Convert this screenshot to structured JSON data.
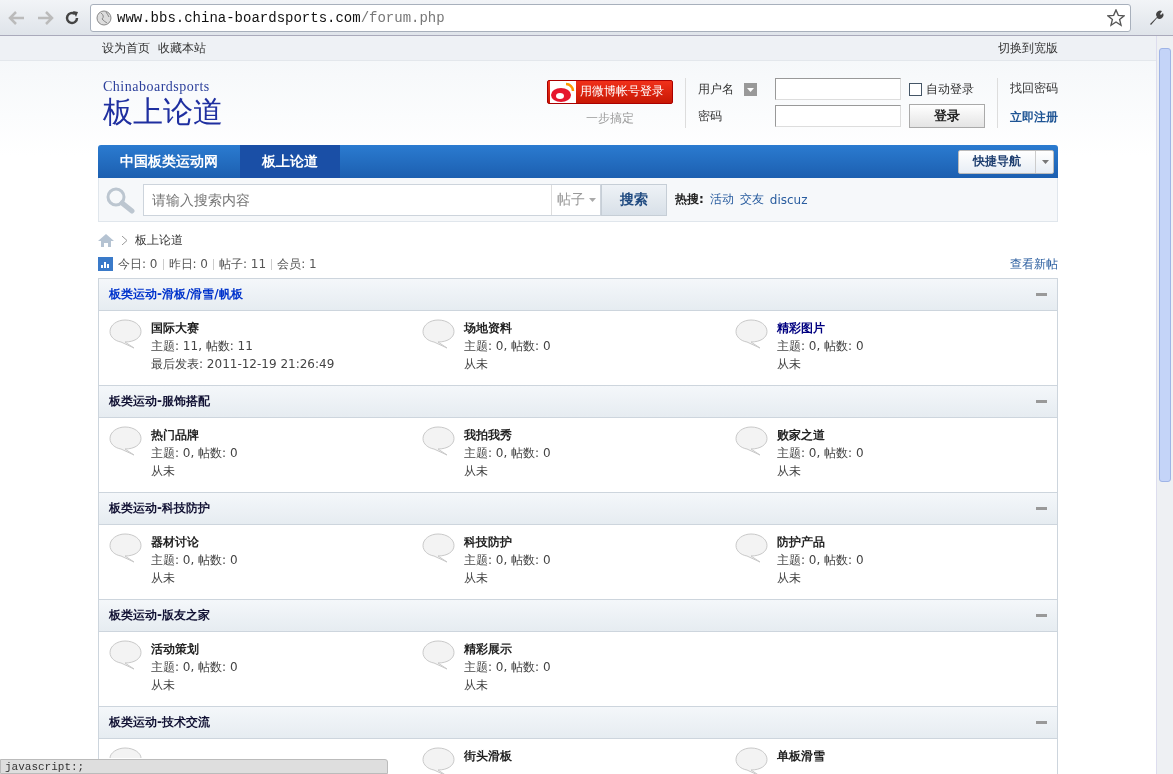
{
  "browser": {
    "url_host": "www.bbs.china-boardsports.com",
    "url_path": "/forum.php",
    "status": "javascript:;"
  },
  "topbar": {
    "links": [
      "设为首页",
      "收藏本站"
    ],
    "right": "切换到宽版"
  },
  "logo": {
    "subtitle": "Chinaboardsports",
    "title": "板上论道"
  },
  "login": {
    "weibo_button": "用微博帐号登录",
    "weibo_hint": "一步搞定",
    "username_label": "用户名",
    "password_label": "密码",
    "auto_login": {
      "label": "自动登录",
      "checked": false
    },
    "login_button": "登录",
    "forgot": "找回密码",
    "register": "立即注册"
  },
  "nav": {
    "tabs": [
      {
        "label": "中国板类运动网",
        "selected": false
      },
      {
        "label": "板上论道",
        "selected": true
      }
    ],
    "quick_nav": "快捷导航"
  },
  "search": {
    "placeholder": "请输入搜索内容",
    "scope": "帖子",
    "button": "搜索",
    "hot_label": "热搜:",
    "hot": [
      "活动",
      "交友",
      "discuz"
    ]
  },
  "breadcrumb": {
    "current": "板上论道"
  },
  "stats": [
    "今日: 0",
    "昨日: 0",
    "帖子: 11",
    "会员: 1"
  ],
  "new_posts": "查看新帖",
  "sections": [
    {
      "title": "板类运动-滑板/滑雪/帆板",
      "color": "#0033cc",
      "forums": [
        {
          "name": "国际大赛",
          "color": "#222222",
          "stats": "主题: 11, 帖数: 11",
          "last": "最后发表: 2011-12-19 21:26:49"
        },
        {
          "name": "场地资料",
          "color": "#222222",
          "stats": "主题: 0, 帖数: 0",
          "last": "从未"
        },
        {
          "name": "精彩图片",
          "color": "#000080",
          "stats": "主题: 0, 帖数: 0",
          "last": "从未"
        }
      ]
    },
    {
      "title": "板类运动-服饰搭配",
      "color": "#111133",
      "forums": [
        {
          "name": "热门品牌",
          "color": "#222222",
          "stats": "主题: 0, 帖数: 0",
          "last": "从未"
        },
        {
          "name": "我拍我秀",
          "color": "#222222",
          "stats": "主题: 0, 帖数: 0",
          "last": "从未"
        },
        {
          "name": "败家之道",
          "color": "#222222",
          "stats": "主题: 0, 帖数: 0",
          "last": "从未"
        }
      ]
    },
    {
      "title": "板类运动-科技防护",
      "color": "#111133",
      "forums": [
        {
          "name": "器材讨论",
          "color": "#222222",
          "stats": "主题: 0, 帖数: 0",
          "last": "从未"
        },
        {
          "name": "科技防护",
          "color": "#222222",
          "stats": "主题: 0, 帖数: 0",
          "last": "从未"
        },
        {
          "name": "防护产品",
          "color": "#222222",
          "stats": "主题: 0, 帖数: 0",
          "last": "从未"
        }
      ]
    },
    {
      "title": "板类运动-版友之家",
      "color": "#111133",
      "forums": [
        {
          "name": "活动策划",
          "color": "#222222",
          "stats": "主题: 0, 帖数: 0",
          "last": "从未"
        },
        {
          "name": "精彩展示",
          "color": "#222222",
          "stats": "主题: 0, 帖数: 0",
          "last": "从未"
        }
      ]
    },
    {
      "title": "板类运动-技术交流",
      "color": "#111133",
      "forums": [
        {
          "kind": "covered"
        },
        {
          "kind": "forum",
          "name": "街头滑板",
          "color": "#222222"
        },
        {
          "kind": "forum",
          "name": "单板滑雪",
          "color": "#222222"
        }
      ]
    }
  ]
}
